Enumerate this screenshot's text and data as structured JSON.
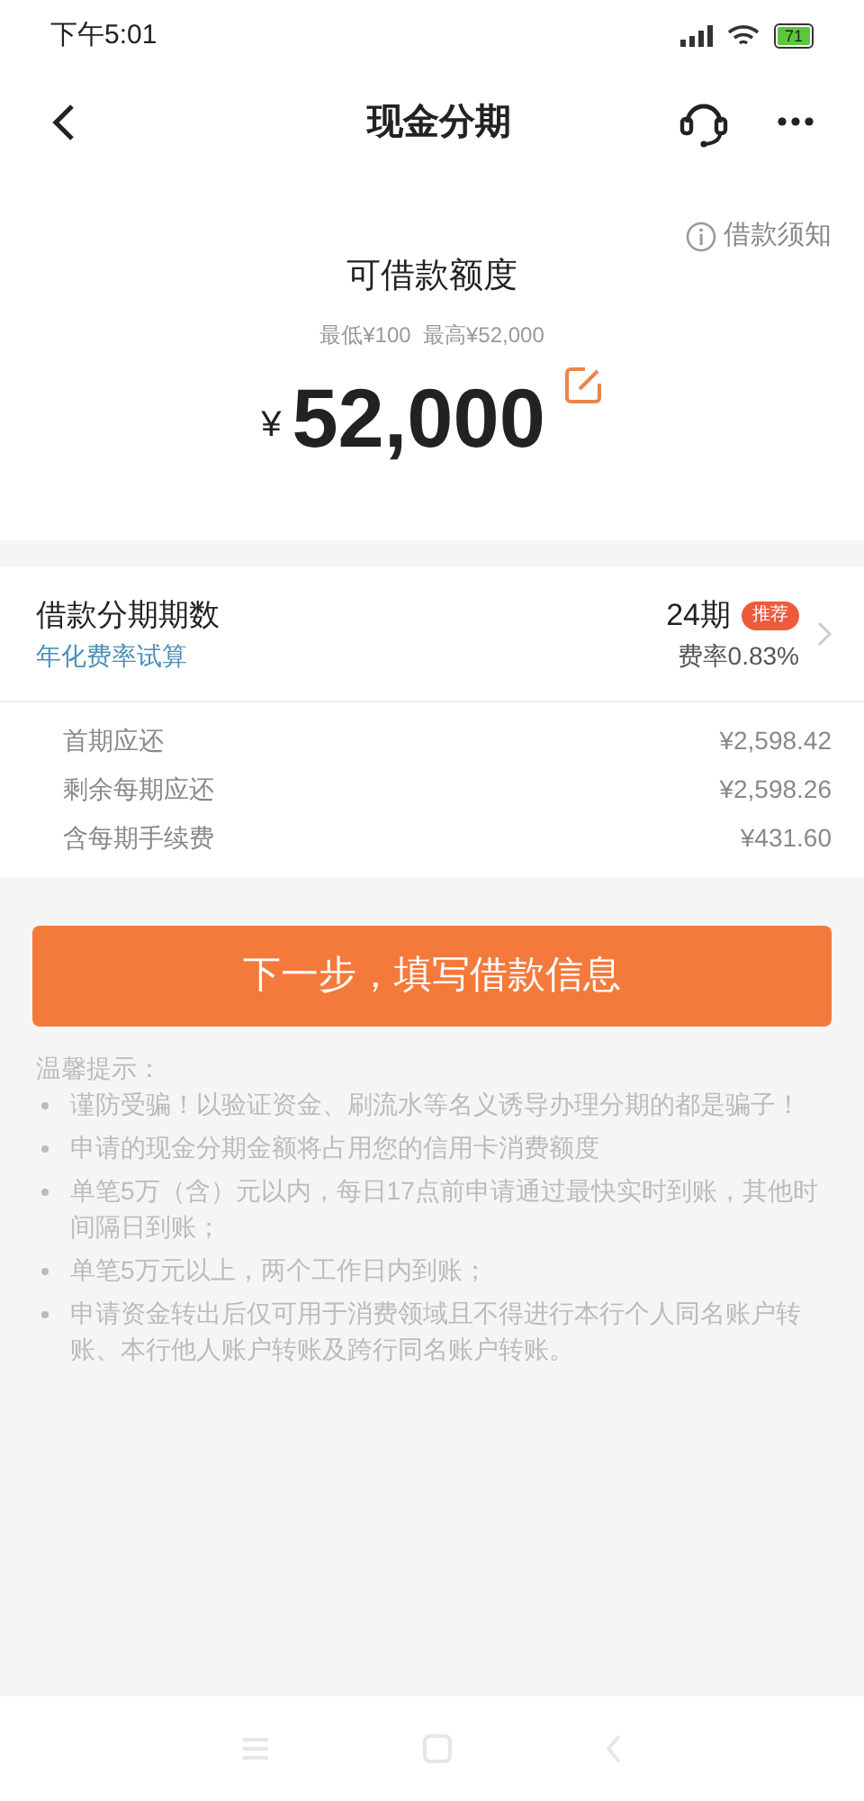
{
  "status_bar": {
    "time": "下午5:01",
    "battery": "71"
  },
  "nav": {
    "title": "现金分期"
  },
  "amount": {
    "notice": "借款须知",
    "label": "可借款额度",
    "range": "最低¥100  最高¥52,000",
    "currency": "¥",
    "value": "52,000"
  },
  "installment": {
    "label": "借款分期期数",
    "link": "年化费率试算",
    "term": "24期",
    "badge": "推荐",
    "rate": "费率0.83%"
  },
  "details": [
    {
      "label": "首期应还",
      "value": "¥2,598.42"
    },
    {
      "label": "剩余每期应还",
      "value": "¥2,598.26"
    },
    {
      "label": "含每期手续费",
      "value": "¥431.60"
    }
  ],
  "next_button": "下一步，填写借款信息",
  "tips": {
    "title": "温馨提示：",
    "items": [
      "谨防受骗！以验证资金、刷流水等名义诱导办理分期的都是骗子！",
      "申请的现金分期金额将占用您的信用卡消费额度",
      "单笔5万（含）元以内，每日17点前申请通过最快实时到账，其他时间隔日到账；",
      "单笔5万元以上，两个工作日内到账；",
      "申请资金转出后仅可用于消费领域且不得进行本行个人同名账户转账、本行他人账户转账及跨行同名账户转账。"
    ]
  }
}
